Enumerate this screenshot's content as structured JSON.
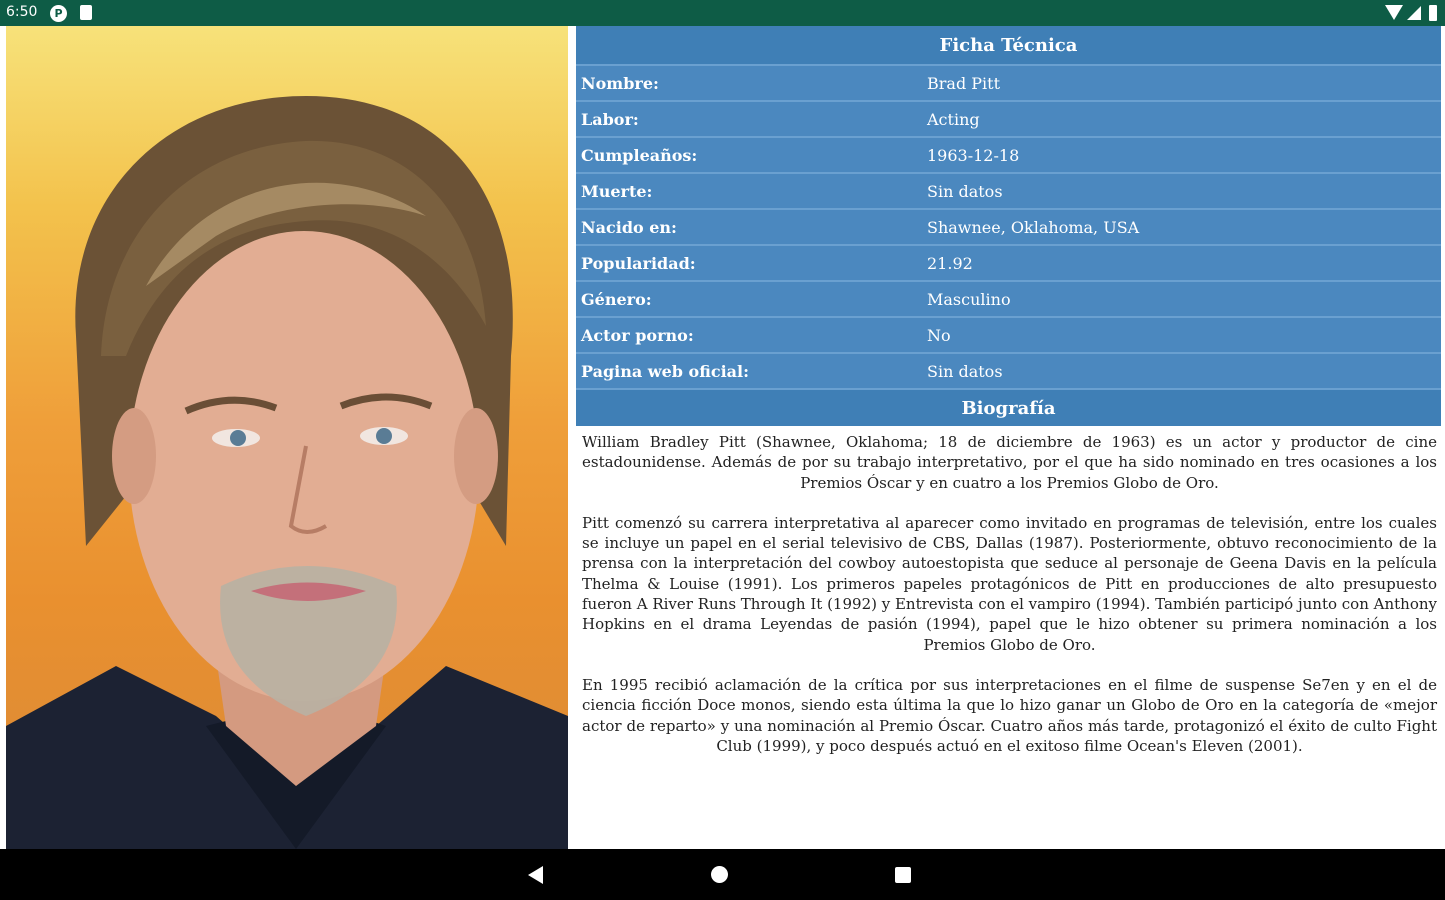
{
  "status_bar": {
    "time": "6:50"
  },
  "ficha": {
    "title": "Ficha Técnica",
    "rows": [
      {
        "label": "Nombre:",
        "value": "Brad Pitt"
      },
      {
        "label": "Labor:",
        "value": "Acting"
      },
      {
        "label": "Cumpleaños:",
        "value": "1963-12-18"
      },
      {
        "label": "Muerte:",
        "value": "Sin datos"
      },
      {
        "label": "Nacido en:",
        "value": "Shawnee, Oklahoma, USA"
      },
      {
        "label": "Popularidad:",
        "value": "21.92"
      },
      {
        "label": "Género:",
        "value": "Masculino"
      },
      {
        "label": "Actor porno:",
        "value": "No"
      },
      {
        "label": "Pagina web oficial:",
        "value": "Sin datos"
      }
    ]
  },
  "biografia": {
    "title": "Biografía",
    "paragraphs": [
      "William Bradley Pitt (Shawnee, Oklahoma; 18 de diciembre de 1963) es un actor y productor de cine estadounidense. Además de por su trabajo interpretativo, por el que ha sido nominado en tres ocasiones a los Premios Óscar y en cuatro a los Premios Globo de Oro.",
      "Pitt comenzó su carrera interpretativa al aparecer como invitado en programas de televisión, entre los cuales se incluye un papel en el serial televisivo de CBS, Dallas (1987). Posteriormente, obtuvo reconocimiento de la prensa con la interpretación del cowboy autoestopista que seduce al personaje de Geena Davis en la película Thelma & Louise (1991). Los primeros papeles protagónicos de Pitt en producciones de alto presupuesto fueron A River Runs Through It (1992) y Entrevista con el vampiro (1994). También participó junto con Anthony Hopkins en el drama Leyendas de pasión (1994), papel que le hizo obtener su primera nominación a los Premios Globo de Oro.",
      "En 1995 recibió aclamación de la crítica por sus interpretaciones en el filme de suspense Se7en y en el de ciencia ficción Doce monos, siendo esta última la que lo hizo ganar un Globo de Oro en la categoría de «mejor actor de reparto» y una nominación al Premio Óscar. Cuatro años más tarde, protagonizó el éxito de culto Fight Club (1999), y poco después actuó en el exitoso filme Ocean's Eleven (2001)."
    ]
  },
  "icons": {
    "nav_back": "back-triangle-icon",
    "nav_home": "home-circle-icon",
    "nav_recent": "recents-square-icon"
  }
}
